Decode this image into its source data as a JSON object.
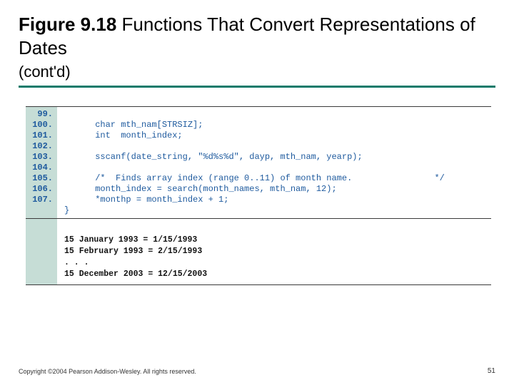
{
  "title": {
    "label": "Figure 9.18",
    "text": "Functions That Convert Representations of Dates",
    "contd": "(cont'd)"
  },
  "code": {
    "line_numbers": [
      "99.",
      "100.",
      "101.",
      "102.",
      "103.",
      "104.",
      "105.",
      "106.",
      "107."
    ],
    "lines": [
      "      char mth_nam[STRSIZ];",
      "      int  month_index;",
      "",
      "      sscanf(date_string, \"%d%s%d\", dayp, mth_nam, yearp);",
      "",
      "      /*  Finds array index (range 0..11) of month name.                */",
      "      month_index = search(month_names, mth_nam, 12);",
      "      *monthp = month_index + 1;",
      "}"
    ]
  },
  "output": {
    "lines": [
      "15 January 1993 = 1/15/1993",
      "15 February 1993 = 2/15/1993",
      ". . .",
      "15 December 2003 = 12/15/2003"
    ]
  },
  "footer": "Copyright ©2004 Pearson Addison-Wesley. All rights reserved.",
  "page_number": "51"
}
